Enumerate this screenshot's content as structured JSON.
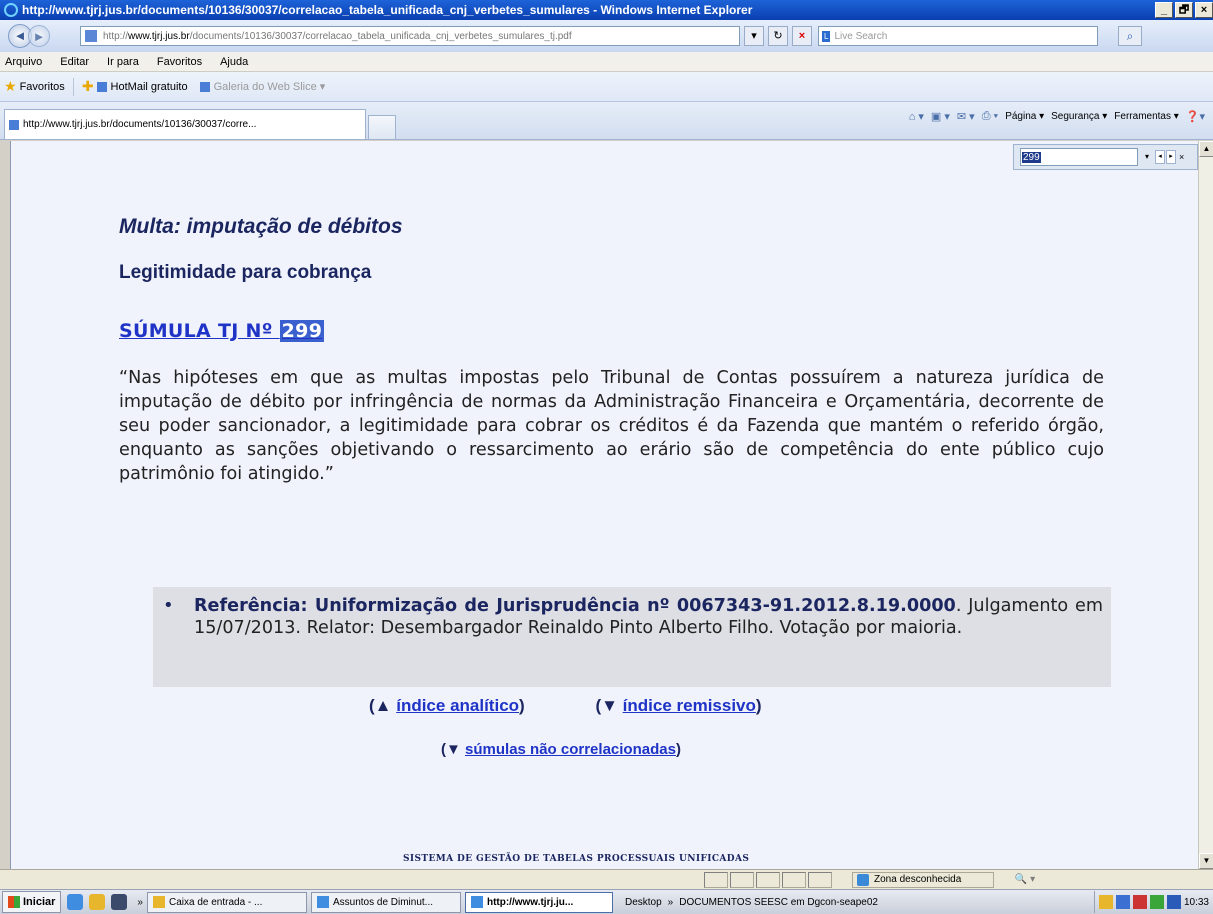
{
  "window": {
    "title": "http://www.tjrj.jus.br/documents/10136/30037/correlacao_tabela_unificada_cnj_verbetes_sumulares - Windows Internet Explorer",
    "min": "_",
    "max": "🗗",
    "close": "×"
  },
  "address": {
    "prefix": "http://",
    "host": "www.tjrj.jus.br",
    "path": "/documents/10136/30037/correlacao_tabela_unificada_cnj_verbetes_sumulares_tj.pdf"
  },
  "search": {
    "placeholder": "Live Search"
  },
  "menu": [
    "Arquivo",
    "Editar",
    "Ir para",
    "Favoritos",
    "Ajuda"
  ],
  "favorites": {
    "label": "Favoritos",
    "links": [
      "HotMail gratuito",
      "Galeria do Web Slice ▾"
    ]
  },
  "tab": {
    "label": "http://www.tjrj.jus.br/documents/10136/30037/corre..."
  },
  "commands": [
    "Página ▾",
    "Segurança ▾",
    "Ferramentas ▾"
  ],
  "find": {
    "value": "299"
  },
  "doc": {
    "topic": "Multa: imputação de débitos",
    "subtopic": "Legitimidade para cobrança",
    "sumula_prefix": "SÚMULA TJ Nº ",
    "sumula_number": "299",
    "quote": "“Nas hipóteses em que as multas impostas pelo Tribunal de Contas possuírem a natureza jurídica de imputação de débito por infringência de normas da Administração Financeira e Orçamentária, decorrente de seu poder sancionador, a legitimidade para cobrar os créditos é da Fazenda que mantém o referido órgão, enquanto as sanções objetivando o ressarcimento ao erário são de competência do ente público cujo patrimônio foi atingido.”",
    "ref_bold": "Referência: Uniformização de Jurisprudência nº 0067343-91.2012.8.19.0000",
    "ref_rest": ". Julgamento em 15/07/2013. Relator: Desembargador Reinaldo Pinto Alberto Filho. Votação por maioria."
  },
  "nav": {
    "analytic_prefix": "(▲ ",
    "analytic": "índice analítico",
    "remissive_prefix": "(▼ ",
    "remissive": "índice remissivo",
    "uncorrelated_prefix": "(▼ ",
    "uncorrelated": "súmulas não correlacionadas",
    "close_paren": ")"
  },
  "footer": "SISTEMA DE GESTÃO DE TABELAS PROCESSUAIS UNIFICADAS",
  "status": {
    "zone": "Zona desconhecida",
    "zoom": "🔍 ▾"
  },
  "taskbar": {
    "start": "Iniciar",
    "buttons": [
      "Caixa de entrada - ...",
      "Assuntos de Diminut...",
      "http://www.tjrj.ju..."
    ],
    "desktop": "Desktop",
    "documents": "DOCUMENTOS SEESC em Dgcon-seape02",
    "clock": "10:33"
  }
}
